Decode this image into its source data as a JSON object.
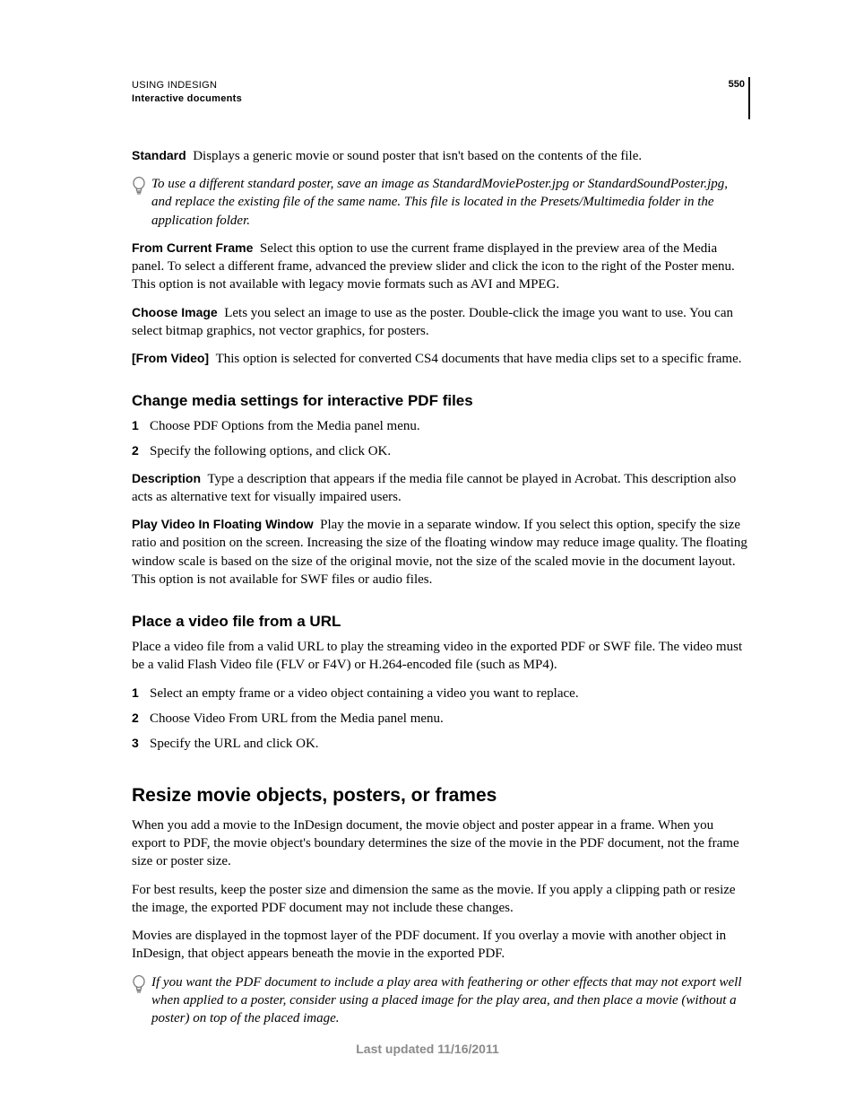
{
  "header": {
    "title": "USING INDESIGN",
    "section": "Interactive documents",
    "page": "550"
  },
  "defs": {
    "standard": {
      "label": "Standard",
      "text": "Displays a generic movie or sound poster that isn't based on the contents of the file."
    },
    "standard_tip": "To use a different standard poster, save an image as StandardMoviePoster.jpg or StandardSoundPoster.jpg, and replace the existing file of the same name. This file is located in the Presets/Multimedia folder in the application folder.",
    "from_current": {
      "label": "From Current Frame",
      "text": "Select this option to use the current frame displayed in the preview area of the Media panel. To select a different frame, advanced the preview slider and click the icon to the right of the Poster menu. This option is not available with legacy movie formats such as AVI and MPEG."
    },
    "choose_image": {
      "label": "Choose Image",
      "text": "Lets you select an image to use as the poster. Double-click the image you want to use. You can select bitmap graphics, not vector graphics, for posters."
    },
    "from_video": {
      "label": "[From Video]",
      "text": "This option is selected for converted CS4 documents that have media clips set to a specific frame."
    }
  },
  "s1": {
    "heading": "Change media settings for interactive PDF files",
    "step1": "Choose PDF Options from the Media panel menu.",
    "step2": "Specify the following options, and click OK.",
    "description": {
      "label": "Description",
      "text": "Type a description that appears if the media file cannot be played in Acrobat. This description also acts as alternative text for visually impaired users."
    },
    "play_float": {
      "label": "Play Video In Floating Window",
      "text": "Play the movie in a separate window. If you select this option, specify the size ratio and position on the screen. Increasing the size of the floating window may reduce image quality. The floating window scale is based on the size of the original movie, not the size of the scaled movie in the document layout. This option is not available for SWF files or audio files."
    }
  },
  "s2": {
    "heading": "Place a video file from a URL",
    "intro": "Place a video file from a valid URL to play the streaming video in the exported PDF or SWF file. The video must be a valid Flash Video file (FLV or F4V) or H.264-encoded file (such as MP4).",
    "step1": "Select an empty frame or a video object containing a video you want to replace.",
    "step2": "Choose Video From URL from the Media panel menu.",
    "step3": "Specify the URL and click OK."
  },
  "s3": {
    "heading": "Resize movie objects, posters, or frames",
    "p1": "When you add a movie to the InDesign document, the movie object and poster appear in a frame. When you export to PDF, the movie object's boundary determines the size of the movie in the PDF document, not the frame size or poster size.",
    "p2": "For best results, keep the poster size and dimension the same as the movie. If you apply a clipping path or resize the image, the exported PDF document may not include these changes.",
    "p3": "Movies are displayed in the topmost layer of the PDF document. If you overlay a movie with another object in InDesign, that object appears beneath the movie in the exported PDF.",
    "tip": "If you want the PDF document to include a play area with feathering or other effects that may not export well when applied to a poster, consider using a placed image for the play area, and then place a movie (without a poster) on top of the placed image."
  },
  "footer": "Last updated 11/16/2011"
}
